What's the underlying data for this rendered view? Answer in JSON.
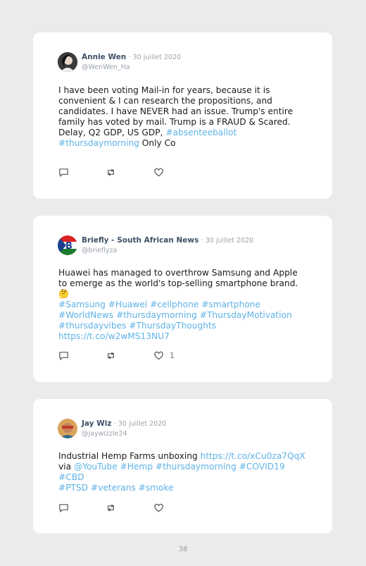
{
  "tweets": [
    {
      "name": "Annie Wen",
      "date": "· 30 juillet 2020",
      "handle": "@WenWen_Ha",
      "text_plain": "I have been voting Mail-in for years, because it is convenient & I can research the propositions, and candidates. I have NEVER had an issue. Trump's entire family has voted by mail. Trump is a FRAUD & Scared. Delay, Q2 GDP, US GDP, ",
      "tag1": "#absenteeballot",
      "tag2": "#thursdaymorning",
      "text_end": " Only Co",
      "like_count": ""
    },
    {
      "name": "Briefly - South African News",
      "date": "· 30 juillet 2020",
      "handle": "@brieflyza",
      "text_plain": "Huawei has managed to overthrow Samsung and Apple to emerge as the world's top-selling smartphone brand.🤔",
      "tags": "#Samsung #Huawei #cellphone #smartphone #WorldNews #thursdaymorning #ThursdayMotivation #thursdayvibes #ThursdayThoughts",
      "url": "https://t.co/w2wMS13NU7",
      "like_count": "1"
    },
    {
      "name": "Jay Wiz",
      "date": "· 30 juillet 2020",
      "handle": "@jaywizzle24",
      "text_plain": "Industrial Hemp Farms unboxing ",
      "url": "https://t.co/xCu0za7QqX",
      "via": "via ",
      "tags1": "@YouTube #Hemp #thursdaymorning #COVID19 #CBD",
      "tags2": "#PTSD #veterans #smoke",
      "like_count": ""
    }
  ],
  "page_number": "38",
  "colors": {
    "link": "#5eb2e6",
    "name": "#3c5064",
    "background": "#ebebea"
  }
}
